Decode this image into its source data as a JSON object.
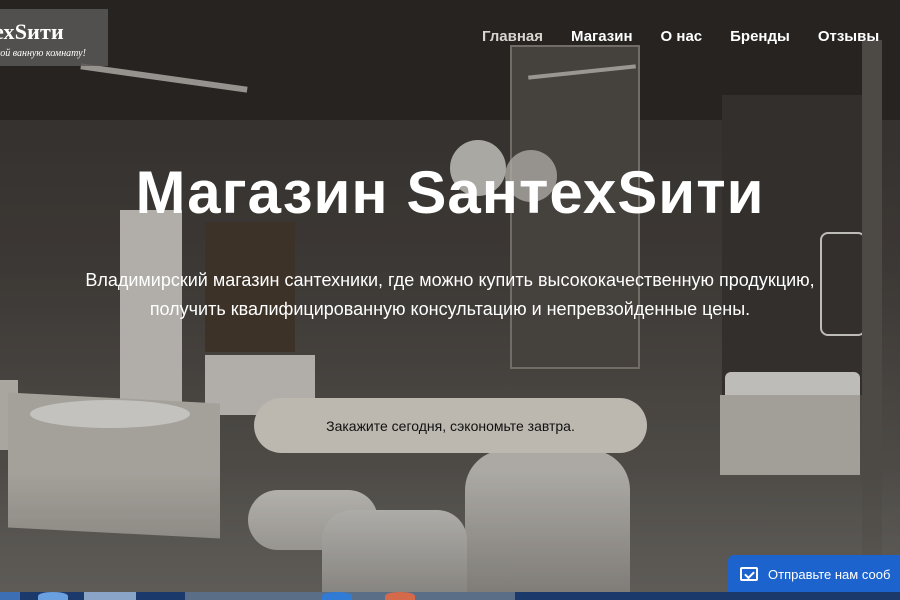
{
  "brand": {
    "title": "ехSити",
    "tagline": "вой ванную комнату!"
  },
  "nav": [
    {
      "label": "Главная",
      "active": true
    },
    {
      "label": "Магазин",
      "active": false
    },
    {
      "label": "О нас",
      "active": false
    },
    {
      "label": "Бренды",
      "active": false
    },
    {
      "label": "Отзывы",
      "active": false
    }
  ],
  "hero": {
    "title": "Магазин SантехSити",
    "subtitle_line1": "Владимирский магазин сантехники, где можно купить высококачественную продукцию,",
    "subtitle_line2": "получить квалифицированную консультацию и непревзойденные цены.",
    "cta": "Закажите сегодня, сэкономьте завтра."
  },
  "chat_widget": {
    "label": "Отправьте нам сооб",
    "icon": "envelope-icon"
  },
  "colors": {
    "cta_bg": "#bcb8b0",
    "chat_bg": "#1d63ce"
  }
}
